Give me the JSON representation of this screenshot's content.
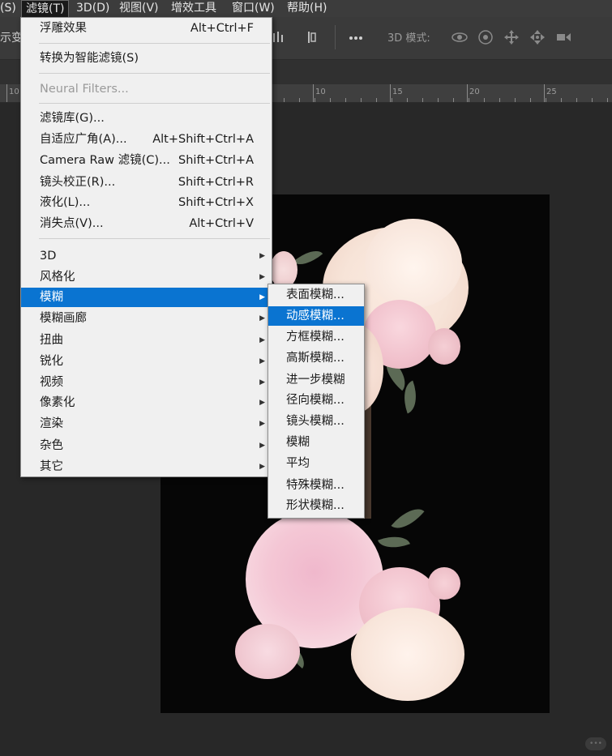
{
  "menubar": {
    "items": [
      {
        "label": "(S)"
      },
      {
        "label": "滤镜(T)"
      },
      {
        "label": "3D(D)"
      },
      {
        "label": "视图(V)"
      },
      {
        "label": "增效工具"
      },
      {
        "label": "窗口(W)"
      },
      {
        "label": "帮助(H)"
      }
    ],
    "active_index": 1
  },
  "options_bar": {
    "truncated_text": "示变",
    "three_d_mode_label": "3D 模式:",
    "icons": [
      "align-icon",
      "distribute-icon",
      "more-icon",
      "orbit-icon",
      "roll-icon",
      "pan-icon",
      "slide-icon",
      "scale-icon"
    ]
  },
  "ruler": {
    "labels": [
      "10",
      "10",
      "15",
      "20",
      "25"
    ]
  },
  "filter_menu": {
    "items": [
      {
        "label": "浮雕效果",
        "shortcut": "Alt+Ctrl+F"
      },
      {
        "label": "转换为智能滤镜(S)",
        "shortcut": ""
      },
      {
        "label": "Neural Filters...",
        "shortcut": "",
        "disabled": true
      },
      {
        "label": "滤镜库(G)...",
        "shortcut": ""
      },
      {
        "label": "自适应广角(A)...",
        "shortcut": "Alt+Shift+Ctrl+A"
      },
      {
        "label": "Camera Raw 滤镜(C)...",
        "shortcut": "Shift+Ctrl+A"
      },
      {
        "label": "镜头校正(R)...",
        "shortcut": "Shift+Ctrl+R"
      },
      {
        "label": "液化(L)...",
        "shortcut": "Shift+Ctrl+X"
      },
      {
        "label": "消失点(V)...",
        "shortcut": "Alt+Ctrl+V"
      },
      {
        "label": "3D",
        "submenu": true
      },
      {
        "label": "风格化",
        "submenu": true
      },
      {
        "label": "模糊",
        "submenu": true,
        "highlighted": true
      },
      {
        "label": "模糊画廊",
        "submenu": true
      },
      {
        "label": "扭曲",
        "submenu": true
      },
      {
        "label": "锐化",
        "submenu": true
      },
      {
        "label": "视频",
        "submenu": true
      },
      {
        "label": "像素化",
        "submenu": true
      },
      {
        "label": "渲染",
        "submenu": true
      },
      {
        "label": "杂色",
        "submenu": true
      },
      {
        "label": "其它",
        "submenu": true
      }
    ]
  },
  "blur_submenu": {
    "items": [
      {
        "label": "表面模糊..."
      },
      {
        "label": "动感模糊...",
        "highlighted": true
      },
      {
        "label": "方框模糊..."
      },
      {
        "label": "高斯模糊..."
      },
      {
        "label": "进一步模糊"
      },
      {
        "label": "径向模糊..."
      },
      {
        "label": "镜头模糊..."
      },
      {
        "label": "模糊"
      },
      {
        "label": "平均"
      },
      {
        "label": "特殊模糊..."
      },
      {
        "label": "形状模糊..."
      }
    ]
  },
  "colors": {
    "highlight": "#0a74d1",
    "menu_bg": "#f0f0f0",
    "app_bg": "#282828",
    "canvas_bg": "#060606"
  }
}
